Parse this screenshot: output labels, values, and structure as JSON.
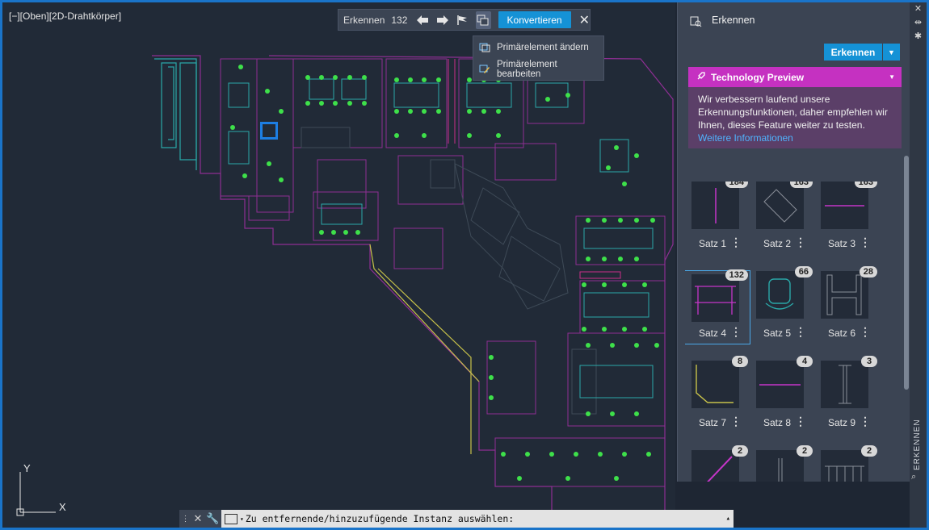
{
  "viewport": {
    "label": "[−][Oben][2D-Drahtkörper]"
  },
  "toolbar": {
    "label": "Erkennen",
    "count": "132",
    "convert_label": "Konvertieren"
  },
  "dropdown": {
    "items": [
      "Primärelement ändern",
      "Primärelement bearbeiten"
    ]
  },
  "ucs": {
    "x": "X",
    "y": "Y"
  },
  "command": {
    "prompt": "Zu entfernende/hinzuzufügende Instanz auswählen:"
  },
  "panel": {
    "title": "Erkennen",
    "button_label": "Erkennen",
    "preview_title": "Technology Preview",
    "preview_text": "Wir verbessern laufend unsere Erkennungsfunktionen, daher empfehlen wir Ihnen, dieses Feature weiter zu testen. ",
    "preview_link": "Weitere Informationen",
    "sets": [
      {
        "label": "Satz 1",
        "count": "184"
      },
      {
        "label": "Satz 2",
        "count": "163"
      },
      {
        "label": "Satz 3",
        "count": "163"
      },
      {
        "label": "Satz 4",
        "count": "132"
      },
      {
        "label": "Satz 5",
        "count": "66"
      },
      {
        "label": "Satz 6",
        "count": "28"
      },
      {
        "label": "Satz 7",
        "count": "8"
      },
      {
        "label": "Satz 8",
        "count": "4"
      },
      {
        "label": "Satz 9",
        "count": "3"
      },
      {
        "label": "",
        "count": "2"
      },
      {
        "label": "",
        "count": "2"
      },
      {
        "label": "",
        "count": "2"
      }
    ]
  },
  "strip": {
    "vertical_label": "ERKENNEN"
  },
  "colors": {
    "accent": "#1592d6",
    "preview_header": "#c531c1",
    "preview_body": "#5b3f68",
    "link": "#4fb4ff"
  }
}
